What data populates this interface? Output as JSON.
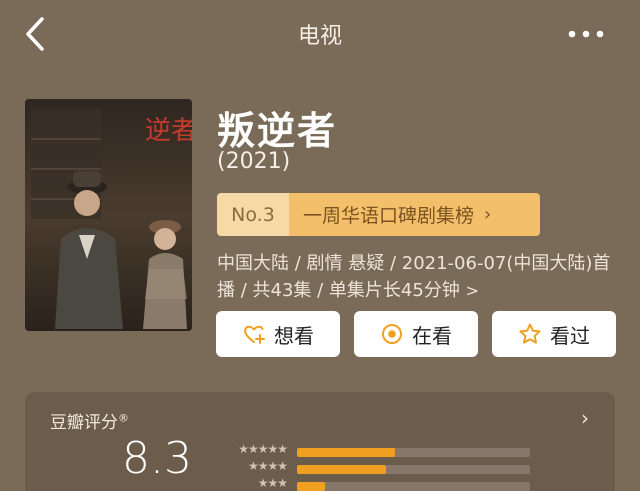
{
  "nav": {
    "title": "电视"
  },
  "movie": {
    "title": "叛逆者",
    "year": "(2021)",
    "poster_text": "逆者",
    "rank": {
      "number": "No.3",
      "name": "一周华语口碑剧集榜",
      "arrow": "›"
    },
    "meta_line1": "中国大陆 / 剧情 悬疑 / 2021-06-07(中国大陆)首",
    "meta_line2": "播 / 共43集 / 单集片长45分钟",
    "meta_arrow": ">"
  },
  "actions": {
    "want": "想看",
    "watching": "在看",
    "watched": "看过"
  },
  "rating": {
    "label": "豆瓣评分",
    "reg": "®",
    "score": "8.3",
    "chevron": "›",
    "distribution": [
      {
        "stars": "★★★★★",
        "fraction": 0.42
      },
      {
        "stars": "★★★★",
        "fraction": 0.38
      },
      {
        "stars": "★★★",
        "fraction": 0.12
      }
    ]
  },
  "colors": {
    "accent": "#f0a020",
    "rank_light": "#f7d9a6",
    "rank_dark": "#f3bf6b",
    "background": "#7a6a58"
  }
}
